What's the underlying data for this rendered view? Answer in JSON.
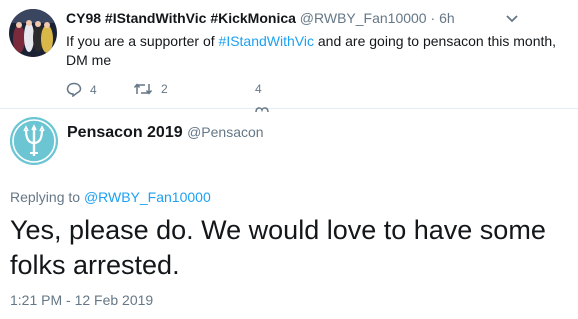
{
  "tweet1": {
    "author_name": "CY98 #IStandWithVic #KickMonica",
    "handle": "@RWBY_Fan10000",
    "separator": "·",
    "time": "6h",
    "text_before": "If you are a supporter of ",
    "hashtag": "#IStandWithVic",
    "text_after": " and are going to pensacon this month, DM me",
    "reply_count": "4",
    "retweet_count": "2",
    "like_count": "4",
    "colors": {
      "link": "#1da1f2",
      "muted": "#657786"
    },
    "icons": [
      "caret-down-icon",
      "reply-icon",
      "retweet-icon",
      "heart-icon"
    ]
  },
  "tweet2": {
    "author_name": "Pensacon 2019",
    "handle": "@Pensacon",
    "replying_prefix": "Replying to ",
    "replying_handle": "@RWBY_Fan10000",
    "text": "Yes, please do. We would love to have some folks arrested.",
    "timestamp": "1:21 PM - 12 Feb 2019",
    "icons": [
      "trident-logo-icon"
    ]
  }
}
